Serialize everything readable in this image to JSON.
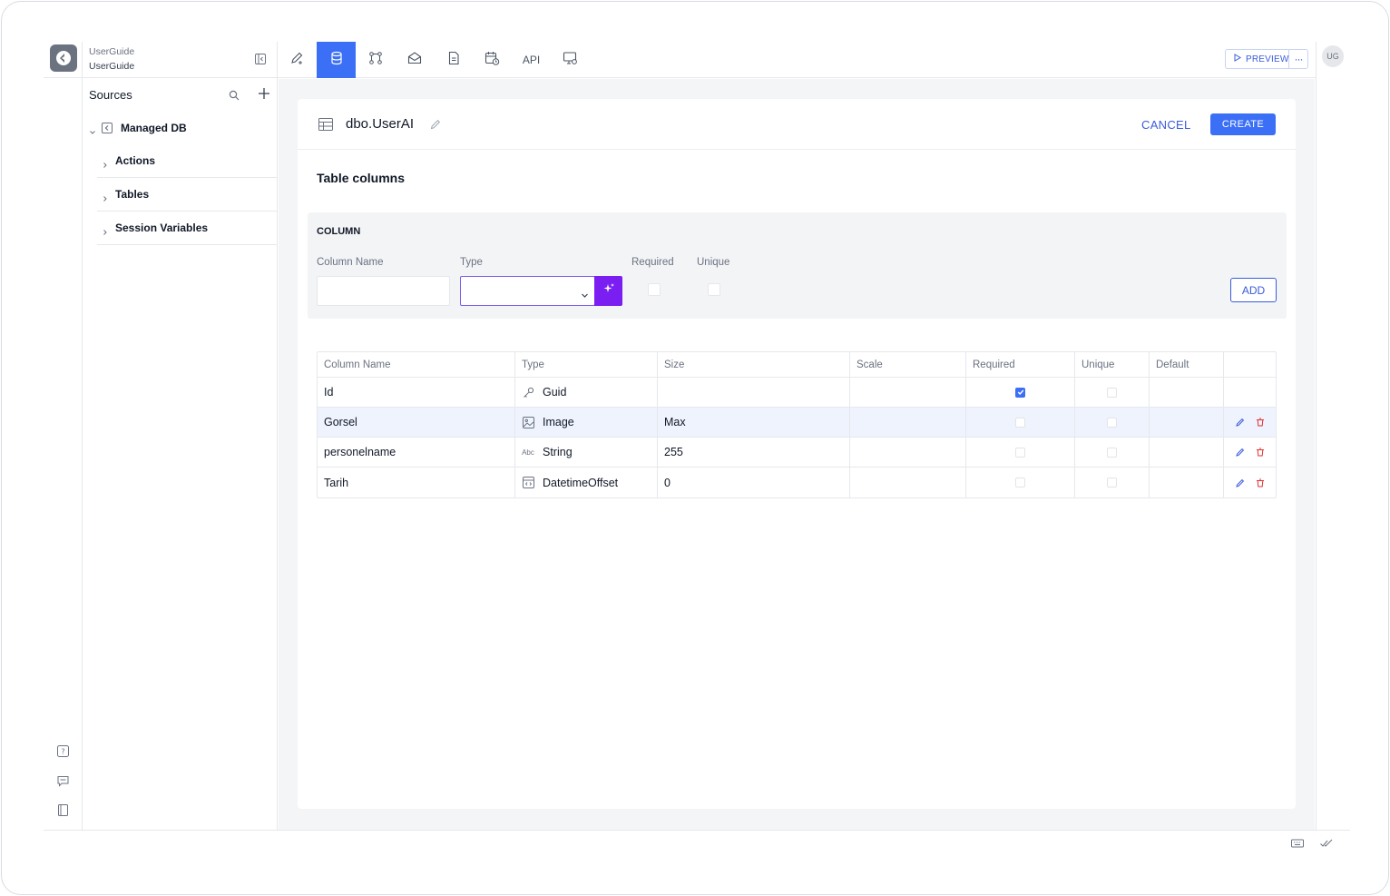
{
  "workspace": {
    "line1": "UserGuide",
    "line2": "UserGuide"
  },
  "sidebar": {
    "sources_title": "Sources",
    "root": {
      "label": "Managed DB",
      "icon": "database-icon",
      "expanded": true
    },
    "items": [
      {
        "label": "Actions"
      },
      {
        "label": "Tables"
      },
      {
        "label": "Session Variables"
      }
    ]
  },
  "toolbar": {
    "tools": [
      {
        "icon": "pen-plus-icon"
      },
      {
        "icon": "database-icon",
        "active": true
      },
      {
        "icon": "workflow-icon"
      },
      {
        "icon": "envelope-icon"
      },
      {
        "icon": "document-icon"
      },
      {
        "icon": "calendar-clock-icon"
      },
      {
        "text": "API"
      },
      {
        "icon": "monitor-settings-icon"
      }
    ],
    "preview_label": "PREVIEW",
    "more_label": "···",
    "avatar_initials": "UG"
  },
  "editor": {
    "table_name": "dbo.UserAI",
    "cancel_label": "CANCEL",
    "create_label": "CREATE",
    "section_title": "Table columns",
    "form": {
      "heading": "COLUMN",
      "column_name_label": "Column Name",
      "column_name_value": "",
      "type_label": "Type",
      "type_value": "",
      "required_label": "Required",
      "unique_label": "Unique",
      "add_label": "ADD"
    },
    "columns_table": {
      "headers": [
        "Column Name",
        "Type",
        "Size",
        "Scale",
        "Required",
        "Unique",
        "Default",
        ""
      ],
      "rows": [
        {
          "name": "Id",
          "type": "Guid",
          "type_icon": "key-icon",
          "size": "",
          "scale": "",
          "required": true,
          "unique": false,
          "default": "",
          "editable": false
        },
        {
          "name": "Gorsel",
          "type": "Image",
          "type_icon": "image-icon",
          "size": "Max",
          "scale": "",
          "required": false,
          "unique": false,
          "default": "",
          "editable": true,
          "selected": true
        },
        {
          "name": "personelname",
          "type": "String",
          "type_icon": "abc-icon",
          "type_icon_text": "Abc",
          "size": "255",
          "scale": "",
          "required": false,
          "unique": false,
          "default": "",
          "editable": true
        },
        {
          "name": "Tarih",
          "type": "DatetimeOffset",
          "type_icon": "datetime-icon",
          "size": "0",
          "scale": "",
          "required": false,
          "unique": false,
          "default": "",
          "editable": true
        }
      ]
    }
  },
  "colors": {
    "accent": "#3b6ff5",
    "ai_button": "#7a1ef2",
    "delete": "#e03131"
  }
}
